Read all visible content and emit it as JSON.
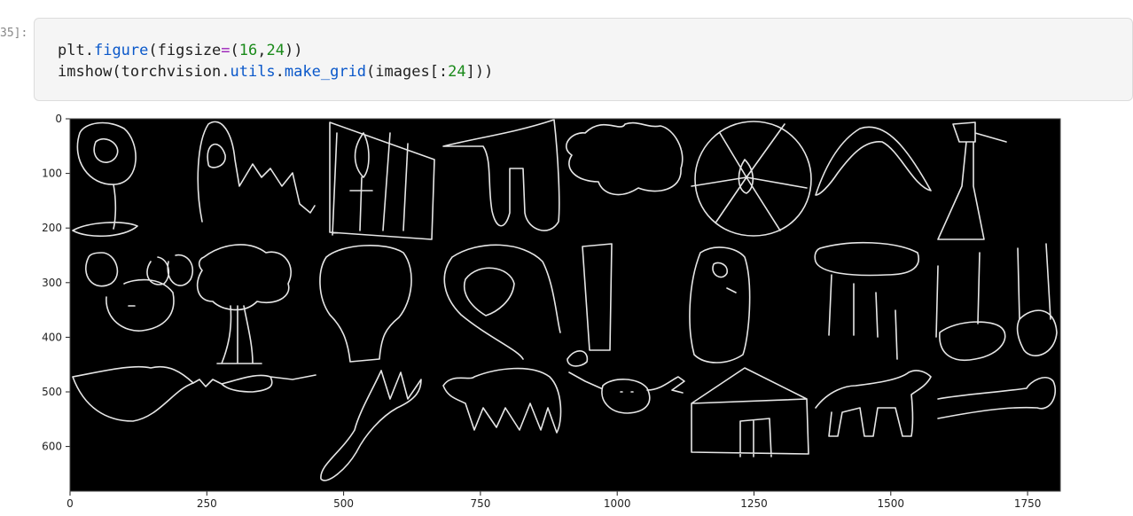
{
  "cell": {
    "prompt": "35]:",
    "line1": [
      {
        "t": "plt",
        "c": "tok-plain"
      },
      {
        "t": ".",
        "c": "tok-plain"
      },
      {
        "t": "figure",
        "c": "tok-attr"
      },
      {
        "t": "(",
        "c": "tok-plain"
      },
      {
        "t": "figsize",
        "c": "tok-plain"
      },
      {
        "t": "=",
        "c": "tok-op"
      },
      {
        "t": "(",
        "c": "tok-plain"
      },
      {
        "t": "16",
        "c": "tok-num"
      },
      {
        "t": ",",
        "c": "tok-plain"
      },
      {
        "t": "24",
        "c": "tok-num"
      },
      {
        "t": "))",
        "c": "tok-plain"
      }
    ],
    "line2": [
      {
        "t": "imshow(torchvision",
        "c": "tok-plain"
      },
      {
        "t": ".",
        "c": "tok-plain"
      },
      {
        "t": "utils",
        "c": "tok-attr"
      },
      {
        "t": ".",
        "c": "tok-plain"
      },
      {
        "t": "make_grid",
        "c": "tok-attr"
      },
      {
        "t": "(images[:",
        "c": "tok-plain"
      },
      {
        "t": "24",
        "c": "tok-num"
      },
      {
        "t": "]))",
        "c": "tok-plain"
      }
    ]
  },
  "output": {
    "x_ticks": [
      "0",
      "250",
      "500",
      "750",
      "1000",
      "1250",
      "1500",
      "1750"
    ],
    "y_ticks": [
      "0",
      "100",
      "200",
      "300",
      "400",
      "500",
      "600"
    ],
    "image_background": "#000000",
    "stroke_color": "#e6e6e6"
  }
}
